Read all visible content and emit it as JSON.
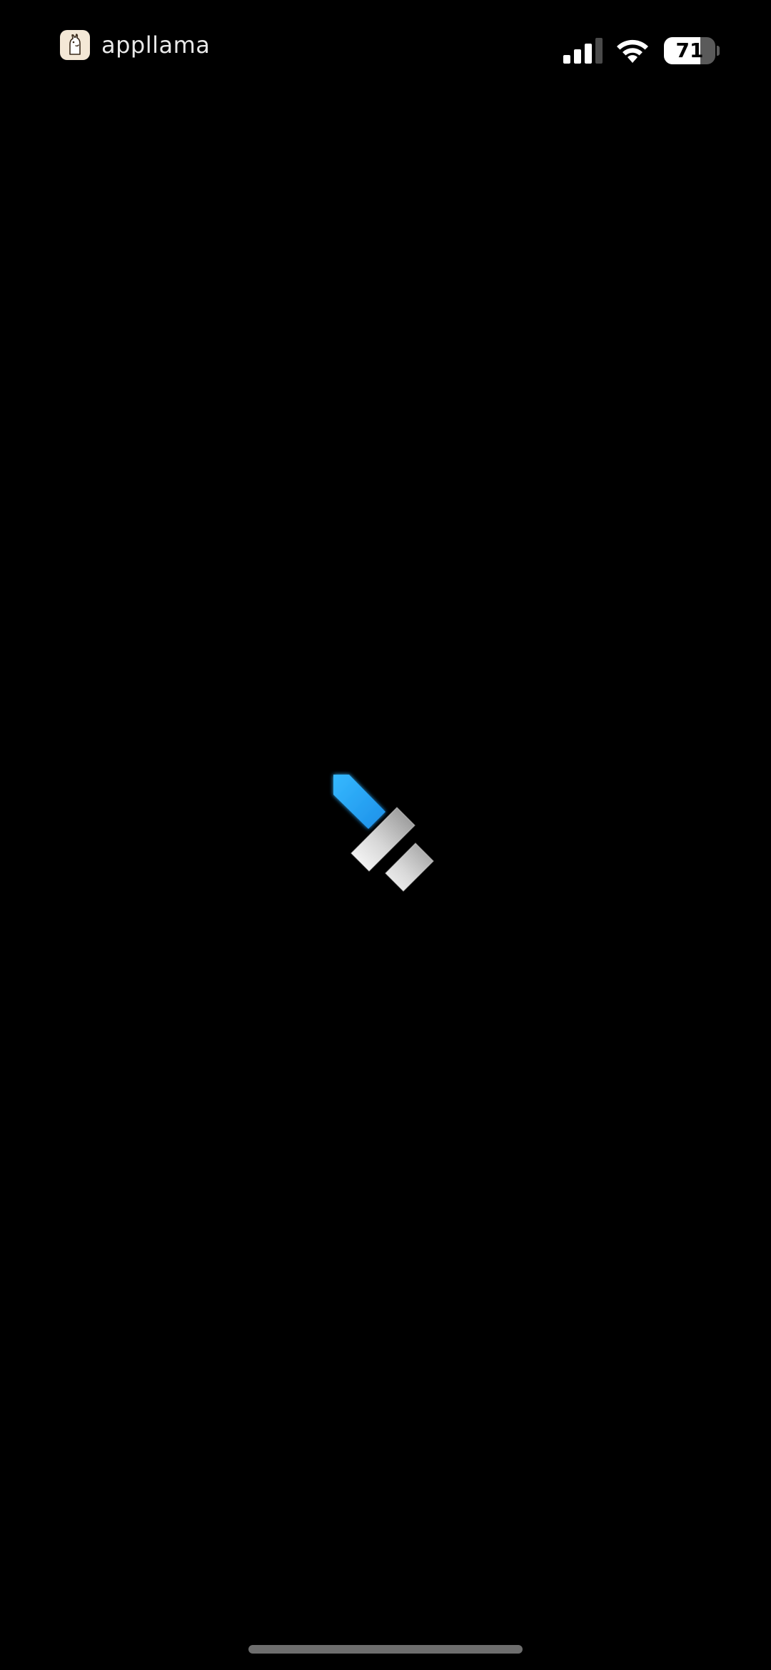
{
  "watermark": {
    "text": "appllama",
    "icon": "llama-icon",
    "logo_bg": "#f4e8d6"
  },
  "status_bar": {
    "signal_icon": "cellular-signal-icon",
    "signal_bars": 3,
    "signal_bars_total": 4,
    "wifi_icon": "wifi-icon",
    "battery_icon": "battery-icon",
    "battery_level": "71",
    "battery_fraction": 0.71
  },
  "splash": {
    "logo_icon": "app-splash-logo-icon",
    "accent_color": "#2aa8f5"
  }
}
